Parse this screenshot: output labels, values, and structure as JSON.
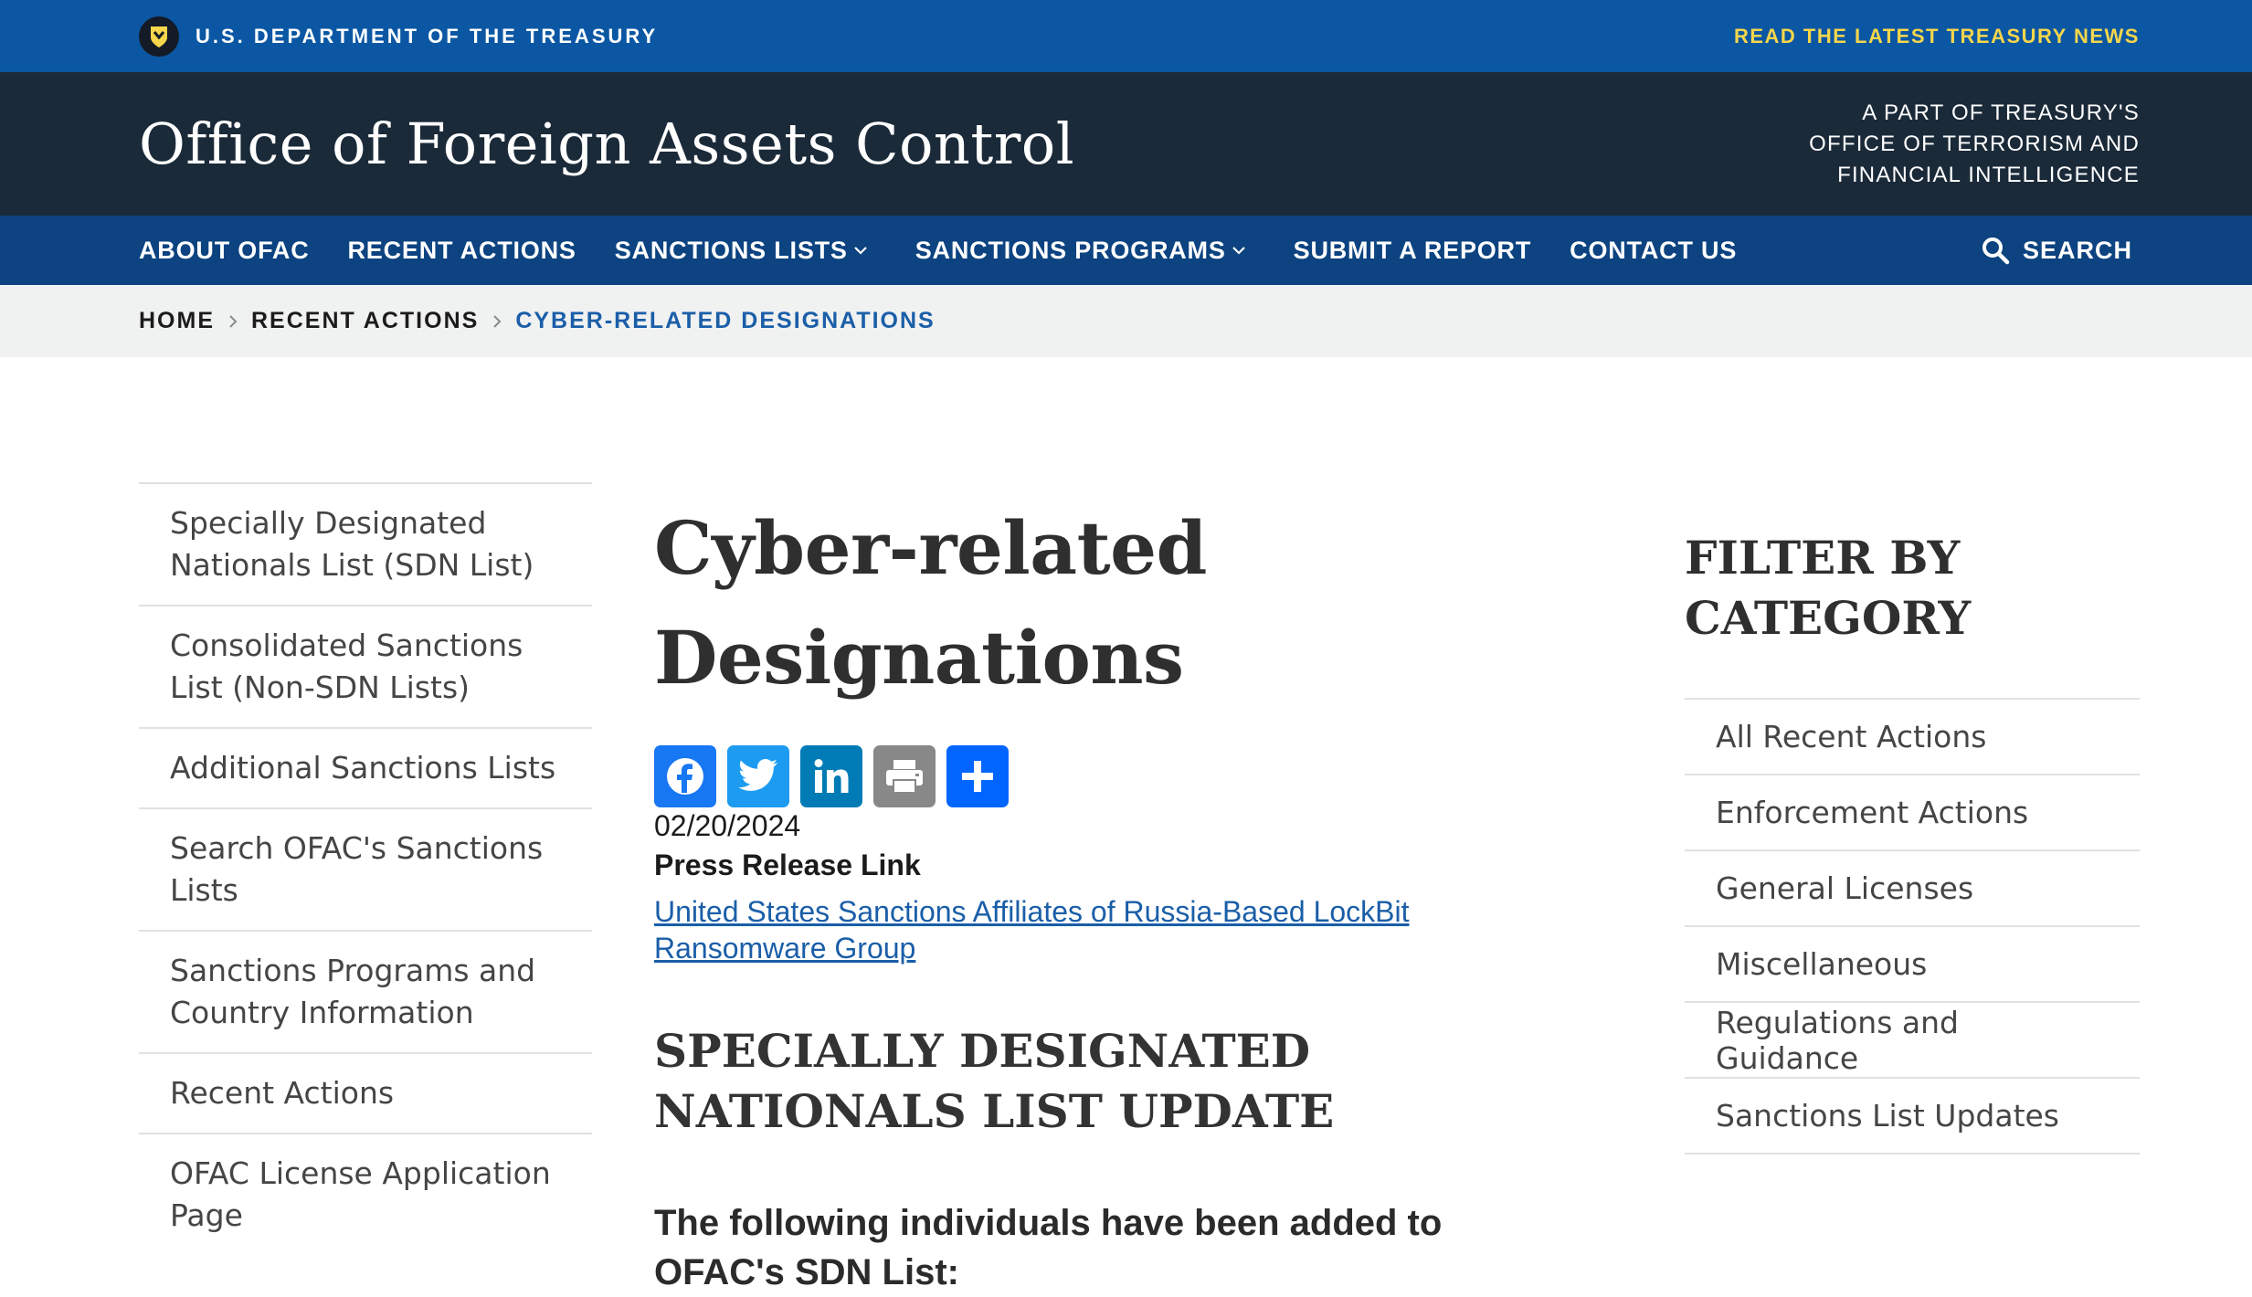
{
  "top_banner": {
    "department": "U.S. DEPARTMENT OF THE TREASURY",
    "news_link": "READ THE LATEST TREASURY NEWS",
    "seal_icon": "treasury-seal-icon"
  },
  "header": {
    "site_title": "Office of Foreign Assets Control",
    "tagline_lines": [
      "A PART OF TREASURY'S",
      "OFFICE OF TERRORISM AND",
      "FINANCIAL INTELLIGENCE"
    ]
  },
  "nav": {
    "items": [
      {
        "label": "ABOUT OFAC",
        "dropdown": false
      },
      {
        "label": "RECENT ACTIONS",
        "dropdown": false
      },
      {
        "label": "SANCTIONS LISTS",
        "dropdown": true
      },
      {
        "label": "SANCTIONS PROGRAMS",
        "dropdown": true
      },
      {
        "label": "SUBMIT A REPORT",
        "dropdown": false
      },
      {
        "label": "CONTACT US",
        "dropdown": false
      }
    ],
    "search_label": "SEARCH"
  },
  "breadcrumb": [
    "HOME",
    "RECENT ACTIONS",
    "CYBER-RELATED DESIGNATIONS"
  ],
  "left_nav": [
    "Specially Designated Nationals List (SDN List)",
    "Consolidated Sanctions List (Non-SDN Lists)",
    "Additional Sanctions Lists",
    "Search OFAC's Sanctions Lists",
    "Sanctions Programs and Country Information",
    "Recent Actions",
    "OFAC License Application Page"
  ],
  "main": {
    "title": "Cyber-related Designations",
    "share_buttons": [
      {
        "name": "facebook",
        "icon": "facebook-icon",
        "color": "#1877f2"
      },
      {
        "name": "twitter",
        "icon": "twitter-icon",
        "color": "#1d9bf0"
      },
      {
        "name": "linkedin",
        "icon": "linkedin-icon",
        "color": "#007bb5"
      },
      {
        "name": "print",
        "icon": "print-icon",
        "color": "#888888"
      },
      {
        "name": "share",
        "icon": "share-plus-icon",
        "color": "#0166ff"
      }
    ],
    "date": "02/20/2024",
    "press_release_label": "Press Release Link",
    "press_release_link": "United States Sanctions Affiliates of Russia-Based LockBit Ransomware Group",
    "section_heading": "SPECIALLY DESIGNATED NATIONALS LIST UPDATE",
    "sub_heading": "The following individuals have been added to OFAC's SDN List:"
  },
  "filter": {
    "title": "FILTER BY CATEGORY",
    "items": [
      "All Recent Actions",
      "Enforcement Actions",
      "General Licenses",
      "Miscellaneous",
      "Regulations and Guidance",
      "Sanctions List Updates"
    ]
  }
}
